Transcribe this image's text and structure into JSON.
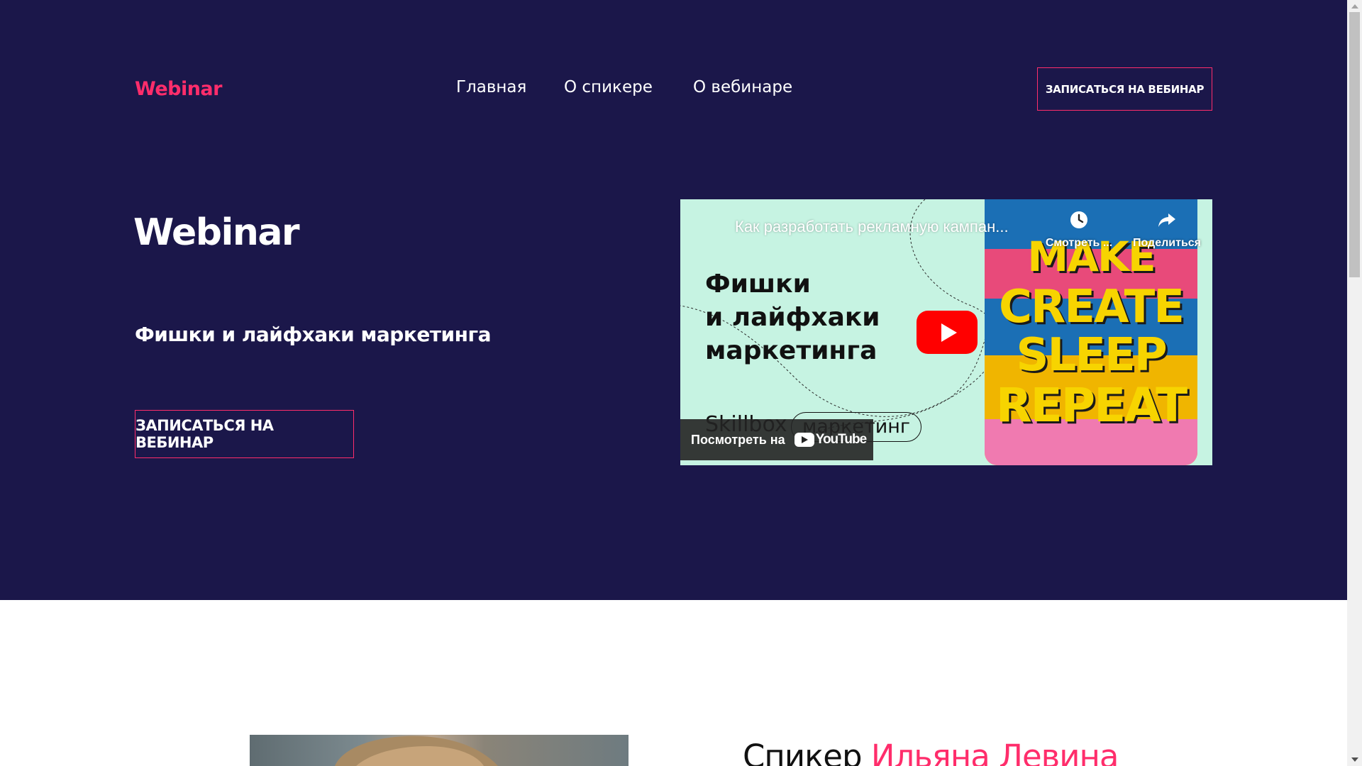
{
  "header": {
    "logo": "Webinar",
    "nav": [
      "Главная",
      "О спикере",
      "О вебинаре"
    ],
    "cta_label": "ЗАПИСАТЬСЯ НА ВЕБИНАР"
  },
  "hero": {
    "title": "Webinar",
    "subtitle": "Фишки и лайфхаки маркетинга",
    "cta_label": "ЗАПИСАТЬСЯ НА ВЕБИНАР"
  },
  "video": {
    "title": "Как разработать рекламную кампан...",
    "heading_lines": [
      "Фишки",
      "и лайфхаки",
      "маркетинга"
    ],
    "brand": "Skillbox",
    "tag": "маркетинг",
    "poster_words": [
      "MAKE",
      "CREATE",
      "SLEEP",
      "REPEAT"
    ],
    "watch_later_label": "Смотреть ...",
    "share_label": "Поделиться",
    "watch_on_label": "Посмотреть на",
    "youtube_label": "YouTube",
    "play_icon": "play-icon",
    "clock_icon": "clock-icon",
    "share_icon": "share-icon"
  },
  "speaker": {
    "label": "Спикер",
    "name": "Ильяна Левина"
  },
  "colors": {
    "hero_bg": "#1b174a",
    "accent": "#ff2d6b",
    "video_bg": "#c6f3e2",
    "youtube_red": "#ff0000"
  }
}
